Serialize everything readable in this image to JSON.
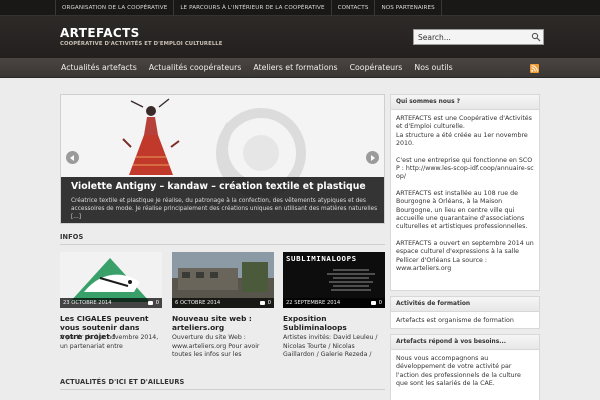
{
  "topnav": [
    "Organisation de la coopérative",
    "Le parcours à l'intérieur de la coopérative",
    "Contacts",
    "Nos partenaires"
  ],
  "site": {
    "title": "ARTEFACTS",
    "tagline": "COOPÉRATIVE D'ACTIVITÉS ET D'EMPLOI CULTURELLE"
  },
  "search": {
    "placeholder": "Search..."
  },
  "mainnav": [
    "Actualités artefacts",
    "Actualités coopérateurs",
    "Ateliers et formations",
    "Coopérateurs",
    "Nos outils"
  ],
  "slider": {
    "title": "Violette Antigny – kandaw – création textile et plastique",
    "text": "Créatrice textile et plastique je réalise, du patronage à la confection, des vêtements atypiques et des accessoires de mode. Je réalise principalement des créations uniques en utilisant des matières naturelles [...]"
  },
  "infos": {
    "heading": "INFOS",
    "posts": [
      {
        "date": "23 OCTOBRE 2014",
        "count": "0",
        "title": "Les CIGALES peuvent vous soutenir dans votre projet !",
        "excerpt": "A partir du 1er novembre 2014, un partenariat entre"
      },
      {
        "date": "6 OCTOBRE 2014",
        "count": "0",
        "title": "Nouveau site web : arteliers.org",
        "excerpt": "Ouverture du site Web : www.arteliers.org Pour avoir toutes les infos sur les"
      },
      {
        "date": "22 SEPTEMBRE 2014",
        "count": "0",
        "title": "Exposition Subliminaloops",
        "excerpt": "Artistes invités: David Leuleu / Nicolas Tourte / Nicolas Gaillardon / Galerie Rezeda /"
      }
    ],
    "thumb3_text": "SUBLIMINALOOPS"
  },
  "actus_heading": "ACTUALITÉS D'ICI ET D'AILLEURS",
  "sidebar": {
    "about": {
      "title": "Qui sommes nous ?",
      "p1": "ARTEFACTS est une Coopérative d'Activités et d'Emploi culturelle.",
      "p1b": "La structure a été créée au 1er novembre 2010.",
      "p2": "C'est une entreprise qui fonctionne en SCOP : http://www.les-scop-idf.coop/annuaire-scop/",
      "p3": "ARTEFACTS est installée au 108 rue de Bourgogne à Orléans, à la Maison Bourgogne, un lieu en centre ville qui accueille une quarantaine d'associations culturelles et artistiques professionnelles.",
      "p4": "ARTEFACTS a ouvert en septembre 2014 un espace culturel d'expressions à la salle Pellicer d'Orléans La source : www.arteliers.org"
    },
    "formation": {
      "title": "Activités de formation",
      "text": "Artefacts est organisme de formation"
    },
    "besoins": {
      "title": "Artefacts répond à vos besoins...",
      "text": "Nous vous accompagnons au développement de votre activité par l'action des professionnels de la culture que sont les salariés de la CAE."
    }
  },
  "colors": {
    "rss": "#f39c34",
    "dark_header": "#2d2a28",
    "nav": "#4a4542"
  }
}
